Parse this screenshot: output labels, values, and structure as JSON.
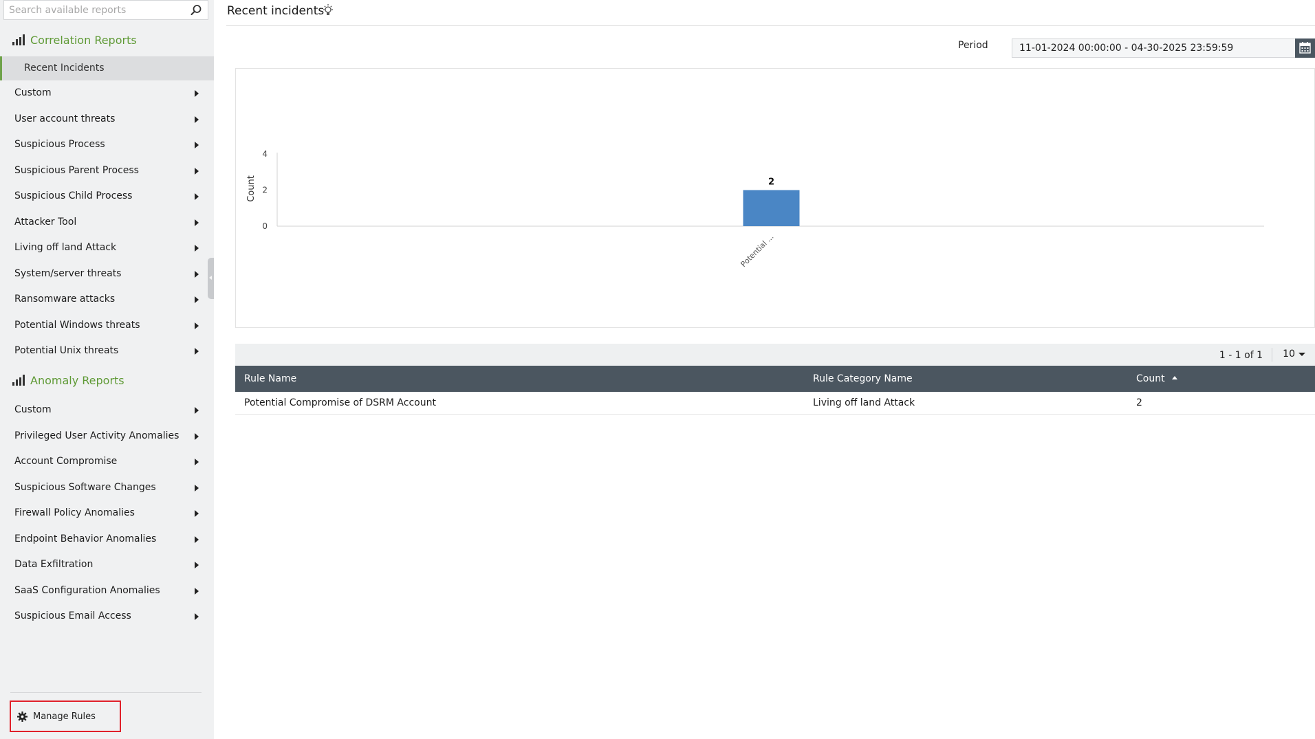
{
  "sidebar": {
    "search_placeholder": "Search available reports",
    "correlation_title": "Correlation Reports",
    "correlation_active": "Recent Incidents",
    "correlation_items": [
      "Custom",
      "User account threats",
      "Suspicious Process",
      "Suspicious Parent Process",
      "Suspicious Child Process",
      "Attacker Tool",
      "Living off land Attack",
      "System/server threats",
      "Ransomware attacks",
      "Potential Windows threats",
      "Potential Unix threats"
    ],
    "anomaly_title": "Anomaly Reports",
    "anomaly_items": [
      "Custom",
      "Privileged User Activity Anomalies",
      "Account Compromise",
      "Suspicious Software Changes",
      "Firewall Policy Anomalies",
      "Endpoint Behavior Anomalies",
      "Data Exfiltration",
      "SaaS Configuration Anomalies",
      "Suspicious Email Access"
    ],
    "manage_rules": "Manage Rules"
  },
  "main": {
    "title": "Recent incidents",
    "period_label": "Period",
    "period_value": "11-01-2024 00:00:00 - 04-30-2025 23:59:59"
  },
  "chart_data": {
    "type": "bar",
    "categories": [
      "Potential ..."
    ],
    "values": [
      2
    ],
    "ylabel": "Count",
    "ylim": [
      0,
      4
    ],
    "yticks": [
      0,
      2,
      4
    ],
    "bar_color": "#4a86c5",
    "data_labels": true,
    "grid": false
  },
  "grid": {
    "pager_text": "1 - 1 of 1",
    "page_size": "10",
    "columns": [
      "Rule Name",
      "Rule Category Name",
      "Count"
    ],
    "rows": [
      [
        "Potential Compromise of DSRM Account",
        "Living off land Attack",
        "2"
      ]
    ]
  },
  "colors": {
    "accent_green": "#5f9a36",
    "header_dark": "#4b5660",
    "highlight_red": "#e0202a"
  }
}
